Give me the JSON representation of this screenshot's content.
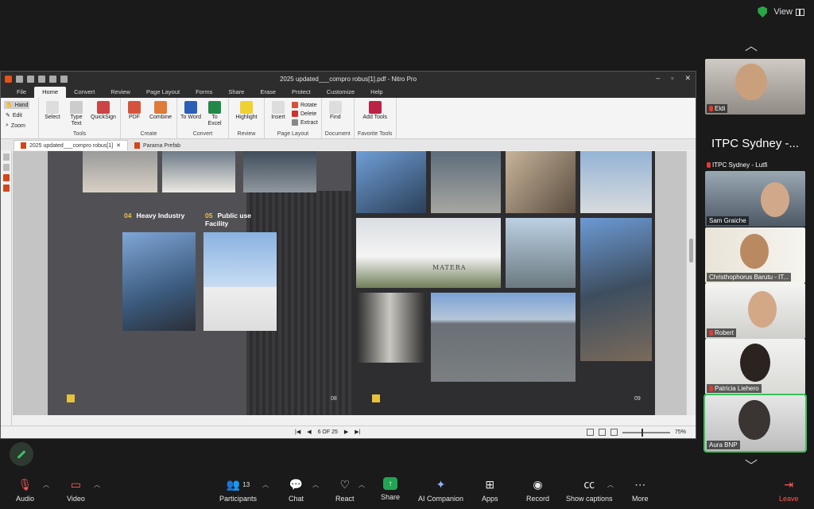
{
  "zoom": {
    "view_label": "View",
    "participants_count": "13",
    "toolbar": {
      "audio": "Audio",
      "video": "Video",
      "participants": "Participants",
      "chat": "Chat",
      "react": "React",
      "share": "Share",
      "ai": "AI Companion",
      "apps": "Apps",
      "record": "Record",
      "captions": "Show captions",
      "more": "More",
      "leave": "Leave"
    },
    "participants": [
      {
        "name": "Eldi",
        "muted": true
      },
      {
        "name": "ITPC Sydney - Lutfi",
        "display": "ITPC Sydney -...",
        "muted": true
      },
      {
        "name": "Sam Graiche",
        "muted": false
      },
      {
        "name": "Christhophorus Barutu - IT...",
        "muted": false
      },
      {
        "name": "Robert",
        "muted": true
      },
      {
        "name": "Patricia Liehero",
        "muted": true
      },
      {
        "name": "Aura BNP",
        "muted": false
      }
    ]
  },
  "nitro": {
    "window_title": "2025 updated___compro robus[1].pdf - Nitro Pro",
    "menu_tabs": [
      "File",
      "Home",
      "Convert",
      "Review",
      "Page Layout",
      "Forms",
      "Share",
      "Erase",
      "Protect",
      "Customize",
      "Help"
    ],
    "active_tab": "Home",
    "left_tools": [
      "Hand",
      "Edit",
      "Zoom"
    ],
    "ribbon": {
      "tools_group": "Tools",
      "select": "Select",
      "type_text": "Type Text",
      "quicksign": "QuickSign",
      "create_group": "Create",
      "pdf": "PDF",
      "combine": "Combine",
      "convert_group": "Convert",
      "to_word": "To Word",
      "to_excel": "To Excel",
      "review_group": "Review",
      "highlight": "Highlight",
      "page_layout_group": "Page Layout",
      "insert": "Insert",
      "rotate": "Rotate",
      "delete": "Delete",
      "extract": "Extract",
      "document_group": "Document",
      "find": "Find",
      "favorite_group": "Favorite Tools",
      "add_tools": "Add Tools"
    },
    "doc_tabs": [
      "2025 updated___compro robus[1]",
      "Parama Prefab"
    ],
    "page_indicator": "6 OF 25",
    "zoom_level": "75%",
    "document": {
      "caption_04_num": "04",
      "caption_04_text": "Heavy Industry",
      "caption_05_num": "05",
      "caption_05_text": "Public use Facility",
      "page_left": "08",
      "page_right": "09",
      "photo_sign": "MATERA"
    }
  }
}
